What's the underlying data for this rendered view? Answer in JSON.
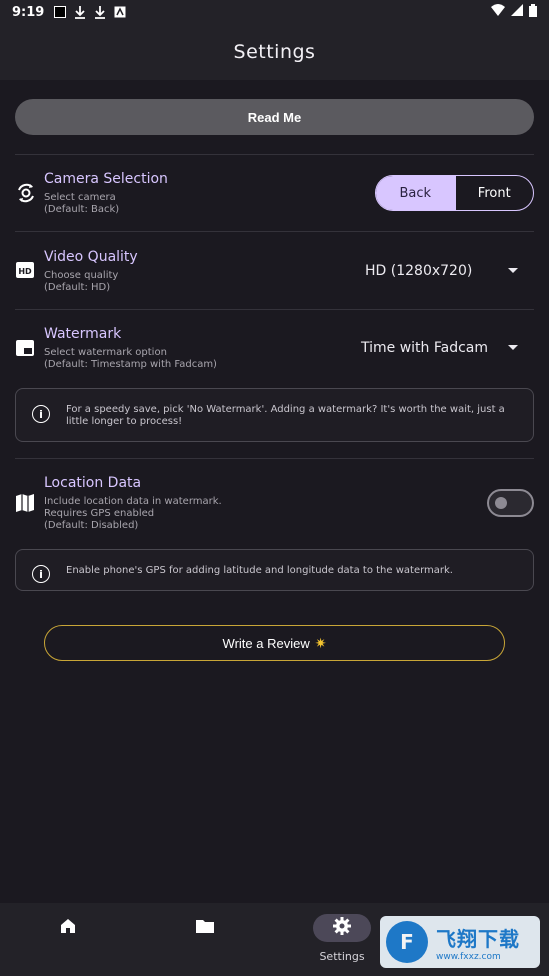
{
  "status_bar": {
    "time": "9:19"
  },
  "app_bar": {
    "title": "Settings"
  },
  "readme_button": "Read Me",
  "camera": {
    "title": "Camera Selection",
    "sub1": "Select camera",
    "sub2": "(Default: Back)",
    "options": [
      "Back",
      "Front"
    ],
    "selected": "Back"
  },
  "quality": {
    "title": "Video Quality",
    "sub1": "Choose quality",
    "sub2": "(Default: HD)",
    "value": "HD (1280x720)"
  },
  "watermark": {
    "title": "Watermark",
    "sub1": "Select watermark option",
    "sub2": "(Default: Timestamp with Fadcam)",
    "value": "Time with Fadcam"
  },
  "watermark_info": "For a speedy save, pick 'No Watermark'. Adding a watermark? It's worth the wait, just a little longer to process!",
  "location": {
    "title": "Location Data",
    "sub1": "Include location data in watermark.",
    "sub2": "Requires GPS enabled",
    "sub3": "(Default: Disabled)",
    "enabled": false
  },
  "location_info": "Enable phone's GPS for adding latitude and longitude data to the watermark.",
  "review_button": "Write a Review",
  "bottom_nav": {
    "items": [
      {
        "icon": "home-icon",
        "label": ""
      },
      {
        "icon": "folder-icon",
        "label": ""
      },
      {
        "icon": "gear-icon",
        "label": "Settings"
      }
    ]
  },
  "site_watermark": {
    "cn": "飞翔下载",
    "url": "www.fxxz.com"
  },
  "colors": {
    "background": "#1b1920",
    "accent": "#d8c6ff",
    "review_border": "#c9a637"
  }
}
